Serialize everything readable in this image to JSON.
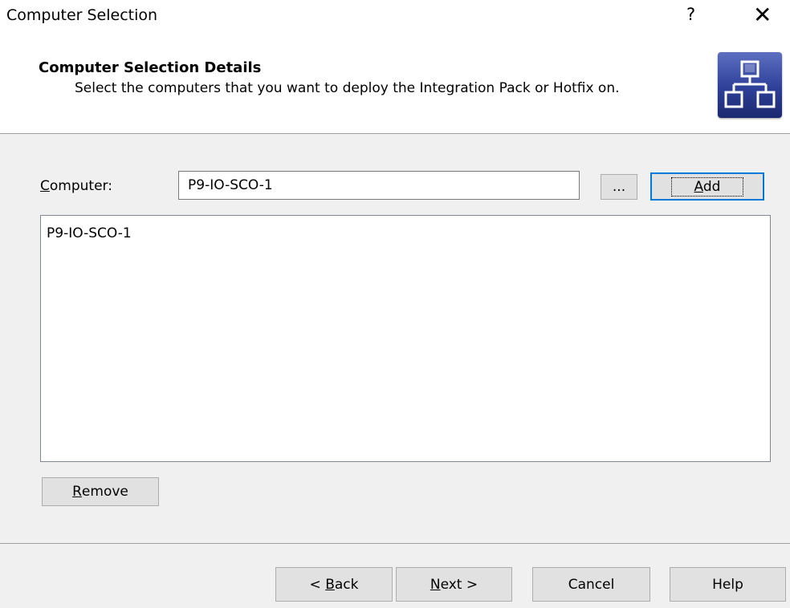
{
  "window": {
    "title": "Computer Selection",
    "help_glyph": "?",
    "close_glyph": "✕"
  },
  "header": {
    "title": "Computer Selection Details",
    "subtitle": "Select the computers that you want to deploy the Integration Pack or Hotfix on.",
    "icon": "network-deploy-icon"
  },
  "form": {
    "computer_label_mnemonic": "C",
    "computer_label_rest": "omputer:",
    "computer_value": "P9-IO-SCO-1",
    "browse_label": "...",
    "add_mnemonic": "A",
    "add_rest": "dd"
  },
  "computer_list": {
    "items": [
      "P9-IO-SCO-1"
    ]
  },
  "remove_button": {
    "mnemonic": "R",
    "rest": "emove"
  },
  "footer": {
    "back_prefix": "< ",
    "back_mnemonic": "B",
    "back_rest": "ack",
    "next_mnemonic": "N",
    "next_rest": "ext >",
    "cancel_label": "Cancel",
    "help_label": "Help"
  },
  "colors": {
    "dialog_bg": "#f0f0f0",
    "header_bg": "#ffffff",
    "focus_border": "#0078d7",
    "button_bg": "#e1e1e1",
    "icon_bg": "#2d3f98"
  }
}
